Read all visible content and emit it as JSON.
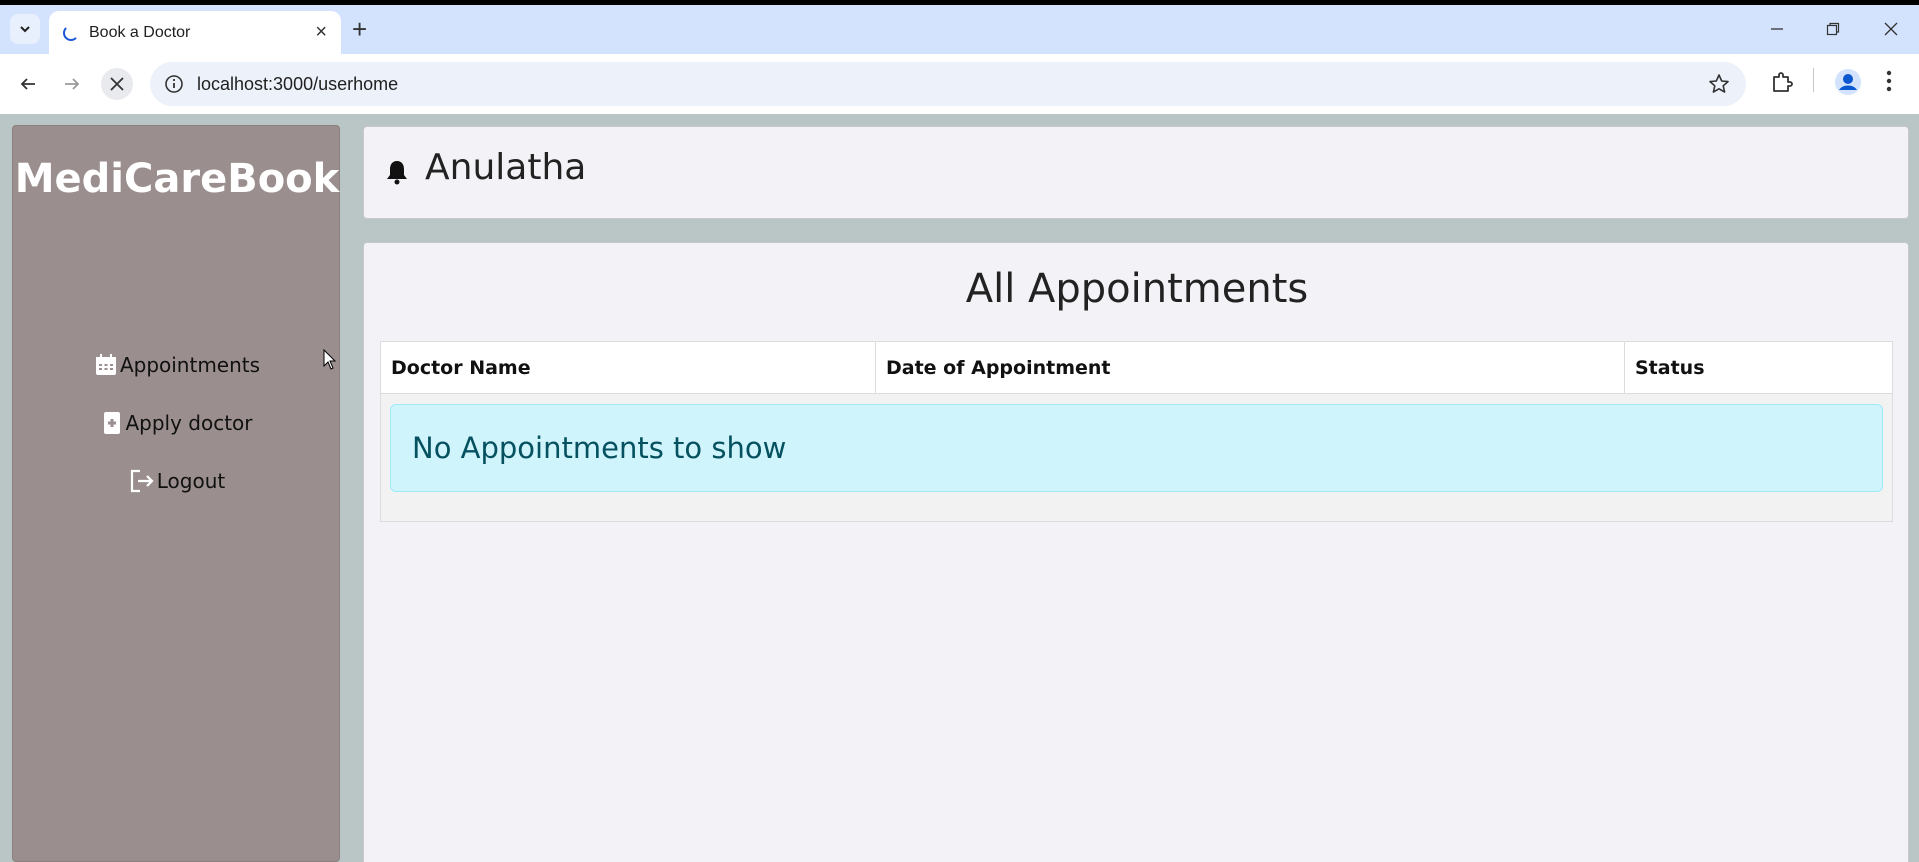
{
  "browser": {
    "tab_title": "Book a Doctor",
    "url": "localhost:3000/userhome"
  },
  "sidebar": {
    "brand": "MediCareBook",
    "items": [
      {
        "label": "Appointments",
        "icon": "calendar-icon"
      },
      {
        "label": "Apply doctor",
        "icon": "medical-file-icon"
      },
      {
        "label": "Logout",
        "icon": "logout-icon"
      }
    ]
  },
  "header": {
    "user_name": "Anulatha"
  },
  "main": {
    "title": "All Appointments",
    "table": {
      "columns": [
        "Doctor Name",
        "Date of Appointment",
        "Status"
      ],
      "empty_message": "No Appointments to show"
    }
  },
  "colors": {
    "sidebar_bg": "#9a8f8e",
    "page_bg": "#b9c6c5",
    "alert_bg": "#cff4fc",
    "alert_text": "#055160"
  }
}
